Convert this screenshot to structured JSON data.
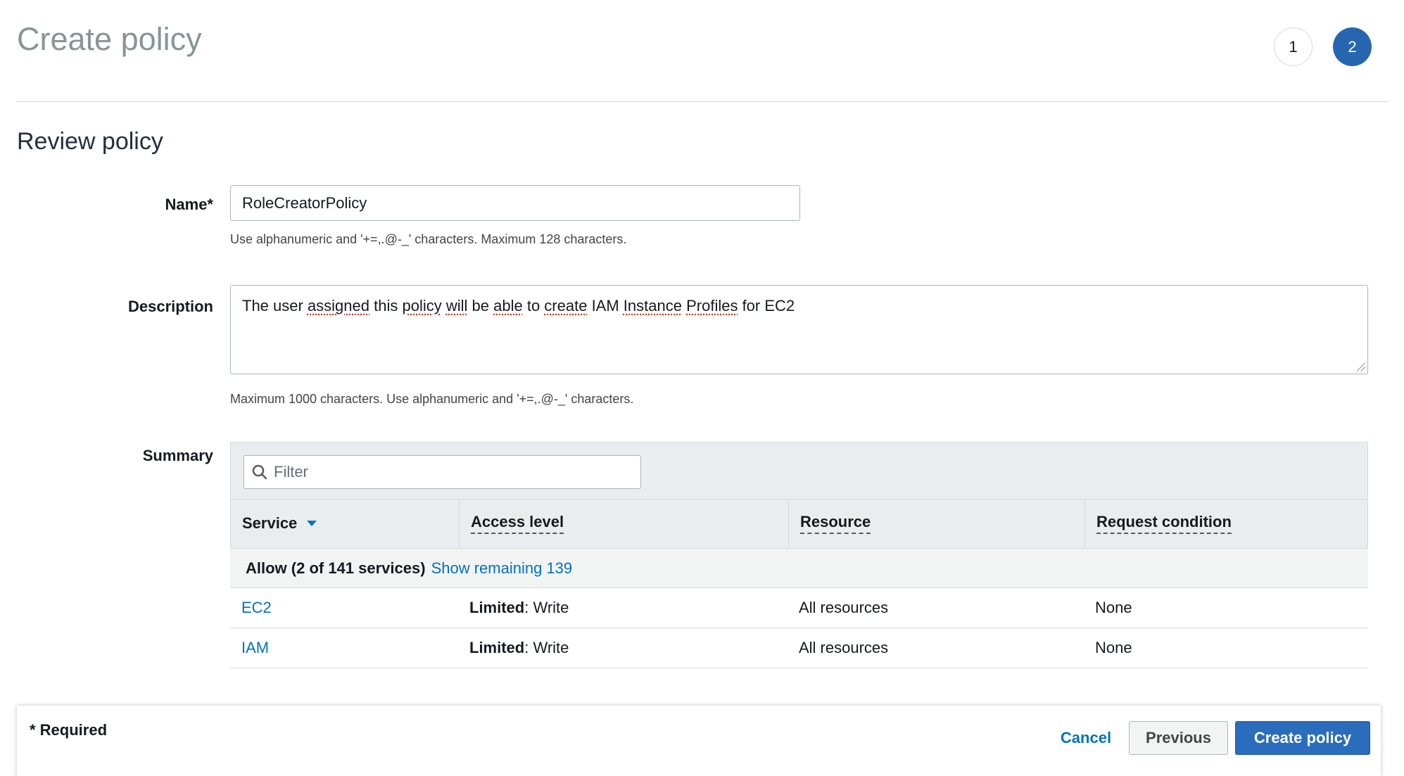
{
  "header": {
    "title": "Create policy",
    "steps": [
      "1",
      "2"
    ],
    "active_step": 2
  },
  "section": {
    "title": "Review policy"
  },
  "form": {
    "name_label": "Name*",
    "name_value": "RoleCreatorPolicy",
    "name_hint": "Use alphanumeric and '+=,.@-_' characters. Maximum 128 characters.",
    "description_label": "Description",
    "description_parts": [
      "The user ",
      "assigned",
      " this ",
      "policy",
      " ",
      "will",
      " be ",
      "able",
      " to ",
      "create",
      " IAM ",
      "Instance",
      " ",
      "Profiles",
      " for EC2"
    ],
    "description_hint": "Maximum 1000 characters. Use alphanumeric and '+=,.@-_' characters.",
    "summary_label": "Summary"
  },
  "summary": {
    "filter_placeholder": "Filter",
    "columns": [
      "Service",
      "Access level",
      "Resource",
      "Request condition"
    ],
    "group": {
      "label": "Allow (2 of 141 services)",
      "link": "Show remaining 139"
    },
    "rows": [
      {
        "service": "EC2",
        "access_bold": "Limited",
        "access_rest": ": Write",
        "resource": "All resources",
        "condition": "None"
      },
      {
        "service": "IAM",
        "access_bold": "Limited",
        "access_rest": ": Write",
        "resource": "All resources",
        "condition": "None"
      }
    ]
  },
  "footer": {
    "required": "* Required",
    "cancel": "Cancel",
    "previous": "Previous",
    "create": "Create policy"
  },
  "colors": {
    "primary": "#2b6dbd",
    "link": "#0073bb",
    "step_active": "#2666b0"
  }
}
